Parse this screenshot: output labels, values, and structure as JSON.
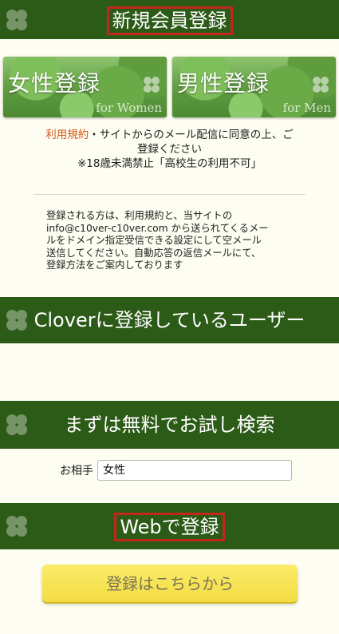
{
  "header": {
    "title": "新規会員登録"
  },
  "gender_buttons": [
    {
      "label": "女性登録",
      "sub": "for Women"
    },
    {
      "label": "男性登録",
      "sub": "for Men"
    }
  ],
  "consent": {
    "terms_link": "利用規約",
    "line1_rest": "・サイトからのメール配信に同意の上、ご",
    "line2": "登録ください",
    "line3": "※18歳未満禁止「高校生の利用不可」"
  },
  "instructions": {
    "line1": "登録される方は、利用規約と、当サイトの",
    "line2": "info@c10ver-c10ver.com から送られてくるメー",
    "line3": "ルをドメイン指定受信できる設定にして空メール",
    "line4": "送信してください。自動応答の返信メールにて、",
    "line5": "登録方法をご案内しております"
  },
  "section_clover": {
    "title": "Cloverに登録しているユーザー"
  },
  "section_search": {
    "title": "まずは無料でお試し検索",
    "partner_label": "お相手",
    "partner_value": "女性"
  },
  "section_web": {
    "title": "Webで登録",
    "cta_label": "登録はこちらから"
  },
  "colors": {
    "band": "#2c5a17",
    "highlight_border": "#c0281c",
    "link": "#d45a1a",
    "cta": "#f3dc42"
  },
  "icons": {
    "band_decoration": "clover-icon"
  }
}
